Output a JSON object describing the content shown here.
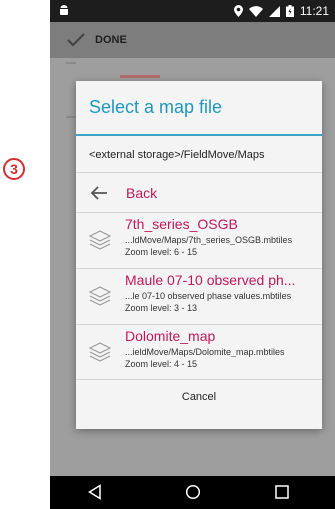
{
  "annotation": {
    "step_number": "3"
  },
  "status_bar": {
    "time": "11:21",
    "icons": [
      "android-icon",
      "location-icon",
      "wifi-icon",
      "signal-icon",
      "battery-icon"
    ]
  },
  "toolbar": {
    "done_label": "DONE"
  },
  "dialog": {
    "title": "Select a map file",
    "path": "<external storage>/FieldMove/Maps",
    "back_label": "Back",
    "files": [
      {
        "name": "7th_series_OSGB",
        "path": "...ldMove/Maps/7th_series_OSGB.mbtiles",
        "zoom": "Zoom level: 6 - 15"
      },
      {
        "name": "Maule 07-10 observed ph...",
        "path": "...le 07-10 observed phase values.mbtiles",
        "zoom": "Zoom level: 3 - 13"
      },
      {
        "name": "Dolomite_map",
        "path": "...ieldMove/Maps/Dolomite_map.mbtiles",
        "zoom": "Zoom level: 4 - 15"
      }
    ],
    "cancel_label": "Cancel"
  },
  "colors": {
    "accent_title": "#1f98bf",
    "file_name": "#c2185b",
    "callout": "#d32f2f"
  }
}
